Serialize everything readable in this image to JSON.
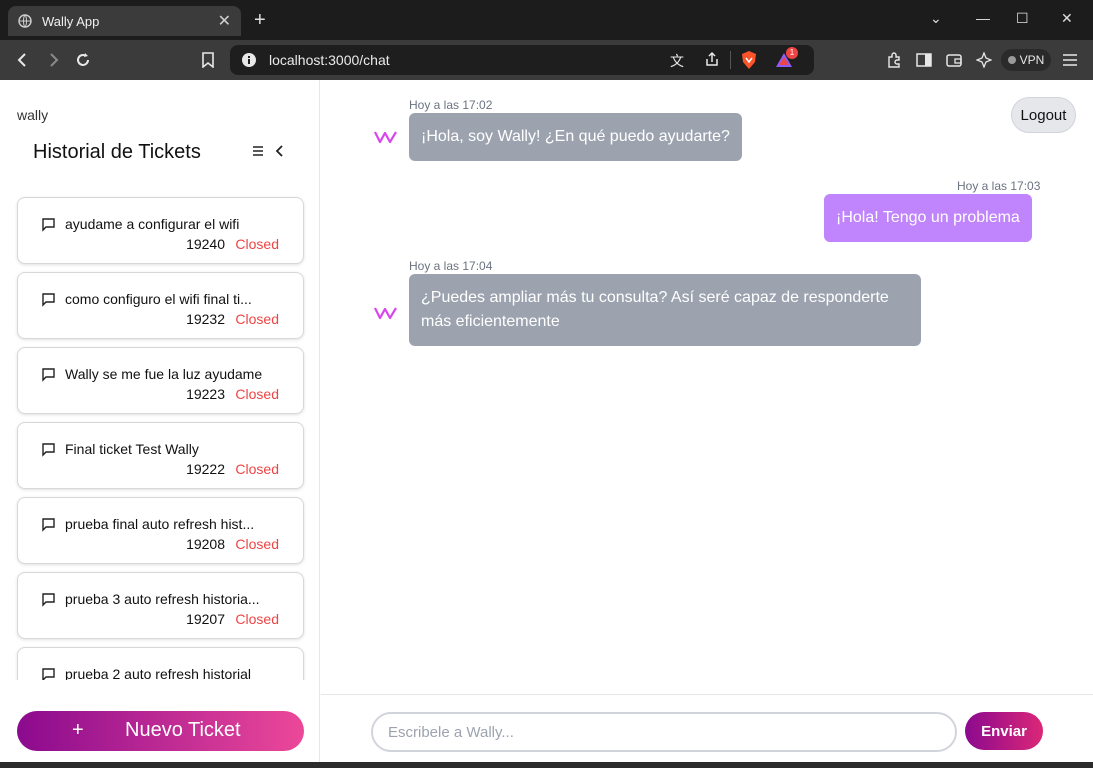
{
  "browser": {
    "tab_title": "Wally App",
    "url": "localhost:3000/chat",
    "vpn_label": "VPN",
    "notification_count": "1"
  },
  "sidebar": {
    "username": "wally",
    "title": "Historial de Tickets",
    "tickets": [
      {
        "title": "ayudame a configurar el wifi",
        "number": "19240",
        "status": "Closed"
      },
      {
        "title": "como configuro el wifi final ti...",
        "number": "19232",
        "status": "Closed"
      },
      {
        "title": "Wally se me fue la luz ayudame",
        "number": "19223",
        "status": "Closed"
      },
      {
        "title": "Final ticket Test Wally",
        "number": "19222",
        "status": "Closed"
      },
      {
        "title": "prueba final auto refresh hist...",
        "number": "19208",
        "status": "Closed"
      },
      {
        "title": "prueba 3 auto refresh historia...",
        "number": "19207",
        "status": "Closed"
      },
      {
        "title": "prueba 2 auto refresh historial",
        "number": "",
        "status": ""
      }
    ],
    "new_ticket_icon": "+",
    "new_ticket_label": "Nuevo Ticket"
  },
  "chat": {
    "logout_label": "Logout",
    "messages": [
      {
        "sender": "bot",
        "time": "Hoy a las 17:02",
        "text": "¡Hola, soy Wally! ¿En qué puedo ayudarte?"
      },
      {
        "sender": "user",
        "time": "Hoy a las 17:03",
        "text": "¡Hola! Tengo un problema"
      },
      {
        "sender": "bot",
        "time": "Hoy a las 17:04",
        "text": "¿Puedes ampliar más tu consulta? Así seré capaz de responderte más eficientemente"
      }
    ],
    "input_placeholder": "Escribele a Wally...",
    "send_label": "Enviar"
  },
  "colors": {
    "accent_start": "#8b0a8e",
    "accent_end": "#ec4899",
    "status_closed": "#ef4444",
    "bot_bubble": "#9ca3af",
    "user_bubble": "#c084fc"
  }
}
